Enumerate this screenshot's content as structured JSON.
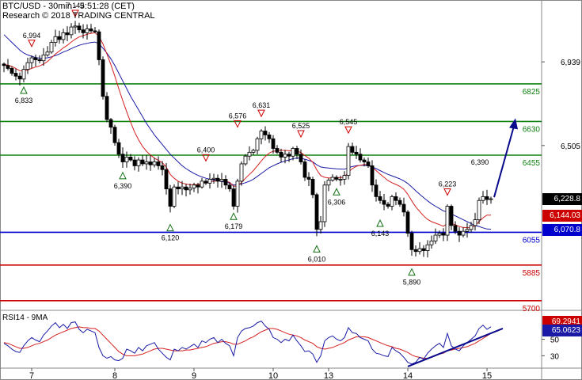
{
  "header": {
    "line1": "BTC/USD - 30min - 5:51:28 (CET)",
    "line2": "Research © 2018 TRADING CENTRAL"
  },
  "colors": {
    "candle": "#000000",
    "ma_fast": "#d62020",
    "ma_slow": "#1a1aa6",
    "resistance": "#108010",
    "support_blue": "#0000cc",
    "support_red": "#cc0000",
    "rsi": "#1a1aa6",
    "rsi_ma": "#d62020",
    "trend": "#0a0a8c",
    "tag_last": "#000000",
    "tag_red": "#cc0000",
    "tag_blue": "#0000cc",
    "tag_rsi_red": "#cc0000",
    "tag_rsi_blue": "#1a1aa6",
    "peak_marker": "#cc0000",
    "trough_marker": "#107010"
  },
  "chart_data": [
    {
      "type": "line",
      "name": "price",
      "x_labels": [
        "7",
        "8",
        "9",
        "10",
        "13",
        "14",
        "15"
      ],
      "y_ticks": [
        6939,
        6505
      ],
      "ylim": [
        5650,
        7260
      ],
      "levels": [
        {
          "value": 6825,
          "label": "6825",
          "color": "resistance"
        },
        {
          "value": 6630,
          "label": "6630",
          "color": "resistance"
        },
        {
          "value": 6455,
          "label": "6455",
          "color": "resistance"
        },
        {
          "value": 6055,
          "label": "6055",
          "color": "support_blue"
        },
        {
          "value": 5885,
          "label": "5885",
          "color": "support_red"
        },
        {
          "value": 5700,
          "label": "5700",
          "color": "support_red"
        }
      ],
      "price_tags": [
        {
          "text": "6,228.8",
          "value": 6228.8,
          "style": "tag_last"
        },
        {
          "text": "6,144.03",
          "value": 6144.03,
          "style": "tag_red"
        },
        {
          "text": "6,070.8",
          "value": 6070.8,
          "style": "tag_blue"
        }
      ],
      "annotations": [
        {
          "label": "7,149",
          "x": 18,
          "value": 7149,
          "kind": "peak"
        },
        {
          "label": "6,994",
          "x": 7,
          "value": 6994,
          "kind": "peak"
        },
        {
          "label": "6,833",
          "x": 5,
          "value": 6833,
          "kind": "trough"
        },
        {
          "label": "6,390",
          "x": 30,
          "value": 6390,
          "kind": "trough"
        },
        {
          "label": "6,120",
          "x": 42,
          "value": 6120,
          "kind": "trough"
        },
        {
          "label": "6,400",
          "x": 51,
          "value": 6400,
          "kind": "peak"
        },
        {
          "label": "6,576",
          "x": 59,
          "value": 6576,
          "kind": "peak"
        },
        {
          "label": "6,179",
          "x": 58,
          "value": 6179,
          "kind": "trough"
        },
        {
          "label": "6,631",
          "x": 65,
          "value": 6631,
          "kind": "peak"
        },
        {
          "label": "6,525",
          "x": 75,
          "value": 6525,
          "kind": "peak"
        },
        {
          "label": "6,010",
          "x": 79,
          "value": 6010,
          "kind": "trough"
        },
        {
          "label": "6,545",
          "x": 87,
          "value": 6545,
          "kind": "peak"
        },
        {
          "label": "6,306",
          "x": 84,
          "value": 6306,
          "kind": "trough"
        },
        {
          "label": "6,143",
          "x": 95,
          "value": 6143,
          "kind": "trough"
        },
        {
          "label": "5,890",
          "x": 103,
          "value": 5890,
          "kind": "trough"
        },
        {
          "label": "6,223",
          "x": 112,
          "value": 6223,
          "kind": "peak"
        },
        {
          "label": "6,390",
          "x": 121,
          "value": 6390,
          "kind": "none"
        }
      ],
      "close": [
        6920,
        6905,
        6880,
        6865,
        6850,
        6900,
        6935,
        6960,
        6950,
        6945,
        6975,
        6990,
        7040,
        7070,
        7055,
        7090,
        7080,
        7120,
        7125,
        7105,
        7090,
        7110,
        7100,
        7095,
        6950,
        6760,
        6640,
        6600,
        6520,
        6460,
        6420,
        6445,
        6430,
        6400,
        6430,
        6410,
        6420,
        6405,
        6420,
        6400,
        6380,
        6280,
        6190,
        6290,
        6280,
        6290,
        6275,
        6285,
        6300,
        6290,
        6320,
        6310,
        6330,
        6335,
        6320,
        6330,
        6300,
        6280,
        6190,
        6320,
        6410,
        6450,
        6470,
        6480,
        6540,
        6580,
        6560,
        6540,
        6490,
        6470,
        6445,
        6460,
        6450,
        6490,
        6460,
        6420,
        6340,
        6330,
        6250,
        6070,
        6110,
        6300,
        6325,
        6340,
        6330,
        6330,
        6350,
        6500,
        6470,
        6460,
        6430,
        6420,
        6400,
        6300,
        6240,
        6220,
        6200,
        6190,
        6240,
        6220,
        6200,
        6160,
        6050,
        5965,
        5955,
        5970,
        5960,
        5990,
        6010,
        6040,
        6050,
        6040,
        6190,
        6090,
        6060,
        6040,
        6060,
        6070,
        6090,
        6120,
        6220,
        6240,
        6225,
        6228.8
      ],
      "ma_fast": [
        6925,
        6922,
        6915,
        6905,
        6893,
        6892,
        6897,
        6905,
        6912,
        6918,
        6928,
        6941,
        6960,
        6980,
        6995,
        7012,
        7025,
        7042,
        7057,
        7068,
        7075,
        7082,
        7087,
        7090,
        7072,
        7032,
        6980,
        6925,
        6865,
        6800,
        6738,
        6680,
        6626,
        6575,
        6535,
        6500,
        6475,
        6456,
        6440,
        6428,
        6416,
        6393,
        6355,
        6335,
        6320,
        6310,
        6305,
        6302,
        6302,
        6303,
        6308,
        6312,
        6316,
        6320,
        6321,
        6323,
        6320,
        6314,
        6293,
        6296,
        6313,
        6335,
        6355,
        6375,
        6400,
        6425,
        6448,
        6466,
        6475,
        6479,
        6480,
        6480,
        6478,
        6478,
        6476,
        6469,
        6453,
        6439,
        6418,
        6379,
        6349,
        6340,
        6337,
        6337,
        6337,
        6338,
        6342,
        6368,
        6385,
        6397,
        6403,
        6406,
        6406,
        6393,
        6375,
        6357,
        6340,
        6323,
        6312,
        6303,
        6293,
        6278,
        6252,
        6218,
        6187,
        6163,
        6140,
        6122,
        6110,
        6102,
        6095,
        6086,
        6101,
        6100,
        6094,
        6085,
        6080,
        6078,
        6080,
        6089,
        6110,
        6130,
        6144,
        6144.03
      ],
      "ma_slow": [
        7080,
        7060,
        7040,
        7020,
        7000,
        6985,
        6975,
        6968,
        6962,
        6958,
        6958,
        6960,
        6965,
        6972,
        6980,
        6990,
        6998,
        7008,
        7017,
        7025,
        7031,
        7035,
        7040,
        7042,
        7033,
        7010,
        6985,
        6955,
        6920,
        6880,
        6840,
        6800,
        6760,
        6725,
        6690,
        6655,
        6620,
        6590,
        6560,
        6535,
        6510,
        6485,
        6460,
        6440,
        6420,
        6400,
        6385,
        6372,
        6360,
        6350,
        6342,
        6335,
        6330,
        6326,
        6322,
        6318,
        6315,
        6310,
        6300,
        6302,
        6306,
        6312,
        6320,
        6330,
        6345,
        6360,
        6375,
        6390,
        6400,
        6410,
        6418,
        6425,
        6430,
        6437,
        6440,
        6440,
        6434,
        6428,
        6420,
        6405,
        6394,
        6390,
        6388,
        6386,
        6384,
        6383,
        6382,
        6390,
        6396,
        6400,
        6402,
        6402,
        6400,
        6394,
        6385,
        6375,
        6365,
        6355,
        6348,
        6340,
        6332,
        6322,
        6308,
        6290,
        6270,
        6252,
        6235,
        6218,
        6203,
        6190,
        6178,
        6166,
        6160,
        6150,
        6140,
        6130,
        6120,
        6110,
        6100,
        6090,
        6085,
        6078,
        6072,
        6070.8
      ]
    },
    {
      "type": "line",
      "name": "RSI",
      "title": "RSI14 - 9MA",
      "y_ticks": [
        50,
        30
      ],
      "ylim": [
        15,
        85
      ],
      "value_tags": [
        {
          "text": "69.2941",
          "value": 69.2941,
          "style": "tag_rsi_red"
        },
        {
          "text": "65.0623",
          "value": 65.0623,
          "style": "tag_rsi_blue"
        }
      ],
      "rsi": [
        45,
        42,
        38,
        35,
        34,
        42,
        48,
        52,
        49,
        47,
        55,
        60,
        66,
        70,
        64,
        68,
        63,
        70,
        71,
        62,
        58,
        62,
        60,
        58,
        40,
        30,
        27,
        29,
        25,
        24,
        27,
        38,
        36,
        33,
        40,
        36,
        42,
        44,
        46,
        38,
        33,
        28,
        25,
        38,
        36,
        40,
        38,
        41,
        44,
        40,
        48,
        46,
        50,
        52,
        46,
        50,
        45,
        42,
        30,
        52,
        60,
        63,
        64,
        66,
        70,
        72,
        66,
        62,
        52,
        50,
        46,
        50,
        48,
        55,
        48,
        42,
        35,
        36,
        32,
        22,
        30,
        48,
        52,
        54,
        50,
        48,
        52,
        64,
        58,
        57,
        52,
        50,
        48,
        38,
        33,
        32,
        30,
        29,
        40,
        36,
        33,
        28,
        22,
        20,
        22,
        28,
        26,
        33,
        38,
        42,
        45,
        40,
        57,
        42,
        38,
        36,
        42,
        46,
        50,
        54,
        63,
        67,
        62,
        65.0623
      ],
      "rsi_ma": [
        46,
        45,
        43,
        41,
        39,
        39,
        40,
        42,
        44,
        45,
        47,
        49,
        52,
        55,
        57,
        59,
        61,
        63,
        64,
        65,
        64,
        64,
        63,
        63,
        60,
        55,
        50,
        45,
        40,
        35,
        32,
        30,
        30,
        30,
        31,
        32,
        34,
        36,
        38,
        39,
        39,
        38,
        37,
        36,
        36,
        36,
        37,
        37,
        38,
        39,
        40,
        41,
        43,
        45,
        46,
        47,
        47,
        46,
        44,
        44,
        46,
        48,
        51,
        53,
        56,
        59,
        61,
        63,
        63,
        62,
        60,
        58,
        56,
        55,
        54,
        52,
        49,
        47,
        45,
        41,
        39,
        38,
        39,
        40,
        42,
        44,
        46,
        49,
        51,
        53,
        53,
        53,
        52,
        50,
        48,
        46,
        44,
        42,
        41,
        39,
        38,
        36,
        34,
        31,
        29,
        28,
        27,
        27,
        28,
        30,
        32,
        33,
        36,
        37,
        38,
        39,
        40,
        41,
        43,
        45,
        48,
        51,
        54,
        57
      ]
    }
  ]
}
